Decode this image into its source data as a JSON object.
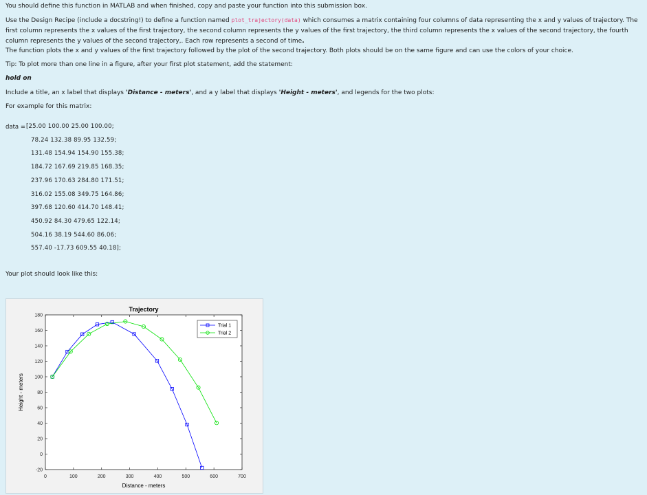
{
  "instructions": {
    "line1": "You should define this function in MATLAB and when finished, copy and paste your function into this submission box.",
    "p2_a": "Use the Design Recipe (include a docstring!) to define a function named ",
    "p2_code": "plot_trajectory(data)",
    "p2_b": " which consumes a matrix containing four columns of data representing the x and y values of trajectory.  The first column represents the x values of the first trajectory, the second column represents the y values of the first trajectory,  the third column represents the x values of the second trajectory, the fourth column represents the y values of the second trajectory,.  Each row represents a second of time",
    "p2_period": ".",
    "p3": "The function plots the x and y values of the first trajectory followed by the plot of the second trajectory. Both plots should be on the same figure and can use the colors of your choice.",
    "tip": "Tip: To plot more than one line in a figure, after your first plot statement, add the statement:",
    "hold": "hold on",
    "p5_a": "Include a title, an x label that displays ",
    "p5_b": "'Distance - meters'",
    "p5_c": ", and a y label that displays ",
    "p5_d": "'Height - meters'",
    "p5_e": ", and legends for the two plots:",
    "example": "For example for this matrix:",
    "data_prefix": "data = ",
    "data_rows": [
      "[25.00  100.00   25.00  100.00;",
      "78.24  132.38   89.95  132.59;",
      "131.48  154.94  154.90  155.38;",
      "184.72  167.69  219.85  168.35;",
      "237.96  170.63  284.80  171.51;",
      "316.02  155.08  349.75  164.86;",
      "397.68  120.60  414.70  148.41;",
      "450.92  84.30  479.65  122.14;",
      "504.16  38.19  544.60  86.06;",
      "557.40  -17.73  609.55  40.18];"
    ],
    "look": "Your plot should look like this:"
  },
  "chart_data": {
    "type": "line",
    "title": "Trajectory",
    "xlabel": "Distance - meters",
    "ylabel": "Height - meters",
    "xlim": [
      0,
      700
    ],
    "ylim": [
      -20,
      180
    ],
    "xticks": [
      0,
      100,
      200,
      300,
      400,
      500,
      600,
      700
    ],
    "yticks": [
      -20,
      0,
      20,
      40,
      60,
      80,
      100,
      120,
      140,
      160,
      180
    ],
    "grid": false,
    "legend_position": "top-right",
    "series": [
      {
        "name": "Trial 1",
        "color": "#0000ff",
        "marker": "square",
        "x": [
          25.0,
          78.24,
          131.48,
          184.72,
          237.96,
          316.02,
          397.68,
          450.92,
          504.16,
          557.4
        ],
        "y": [
          100.0,
          132.38,
          154.94,
          167.69,
          170.63,
          155.08,
          120.6,
          84.3,
          38.19,
          -17.73
        ]
      },
      {
        "name": "Trial 2",
        "color": "#00e000",
        "marker": "circle",
        "x": [
          25.0,
          89.95,
          154.9,
          219.85,
          284.8,
          349.75,
          414.7,
          479.65,
          544.6,
          609.55
        ],
        "y": [
          100.0,
          132.59,
          155.38,
          168.35,
          171.51,
          164.86,
          148.41,
          122.14,
          86.06,
          40.18
        ]
      }
    ]
  }
}
